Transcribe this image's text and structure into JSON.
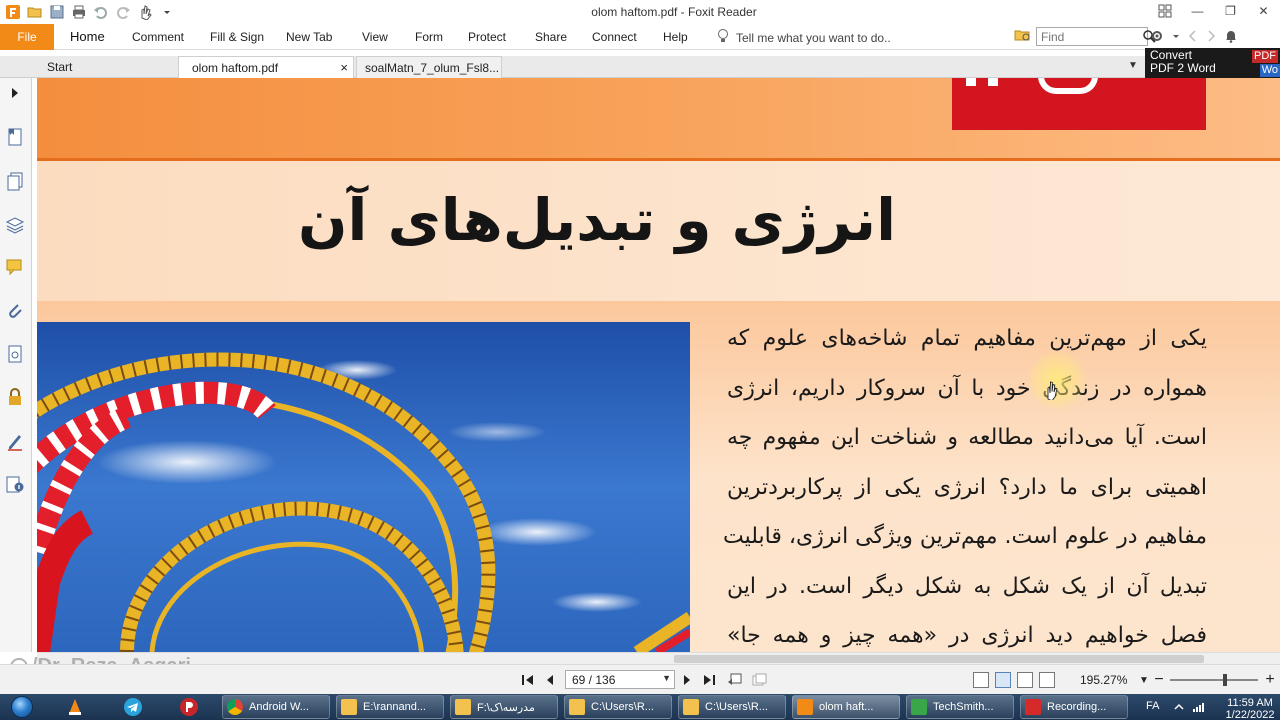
{
  "window": {
    "title": "olom haftom.pdf - Foxit Reader",
    "minimize": "—",
    "maximize": "❐",
    "close": "✕"
  },
  "menu": {
    "file": "File",
    "items": [
      "Home",
      "Comment",
      "Fill & Sign",
      "New Tab",
      "View",
      "Form",
      "Protect",
      "Share",
      "Connect",
      "Help"
    ],
    "tell_me": "Tell me what you want to do..",
    "find_placeholder": "Find"
  },
  "tabs": {
    "start": "Start",
    "active": "olom haftom.pdf",
    "other": "soalMatn_7_olum_Fsl8...",
    "close": "×"
  },
  "convert": {
    "line1": "Convert",
    "line2": "PDF 2 Word",
    "pdf_badge": "PDF",
    "word_badge": "Wo"
  },
  "document": {
    "chapter_title": "انرژی و تبدیل‌های آن",
    "paragraph_lines": [
      "یکی از مهم‌ترین مفاهیم تمام شاخه‌های علوم که",
      "همواره در زندگی خود با آن سروکار داریم، انرژی",
      "است. آیا می‌دانید مطالعه و شناخت این مفهوم چه",
      "اهمیتی برای ما دارد؟ انرژی یکی از پرکاربردترین",
      "مفاهیم در علوم است. مهم‌ترین ویژگی انرژی، قابلیت",
      "تبدیل آن از یک شکل به شکل دیگر است. در این",
      "فصل خواهیم دید انرژی در «همه چیز و همه جا»"
    ]
  },
  "watermark": "/Dr_Reza_Asgari",
  "status": {
    "page_display": "69 / 136",
    "current_page": 69,
    "total_pages": 136,
    "zoom": "195.27%",
    "zoom_minus": "−",
    "zoom_plus": "+"
  },
  "taskbar": {
    "buttons": [
      "Android W...",
      "E:\\rannand...",
      "F:\\مدرسه\\ک",
      "C:\\Users\\R...",
      "C:\\Users\\R...",
      "olom haft...",
      "TechSmith...",
      "Recording..."
    ],
    "language": "FA",
    "time": "11:59 AM",
    "date": "1/22/2022"
  },
  "colors": {
    "accent_orange": "#f28a17",
    "band_orange": "#f48e3e",
    "red_box": "#d3151f",
    "taskbar": "#1b3350"
  }
}
